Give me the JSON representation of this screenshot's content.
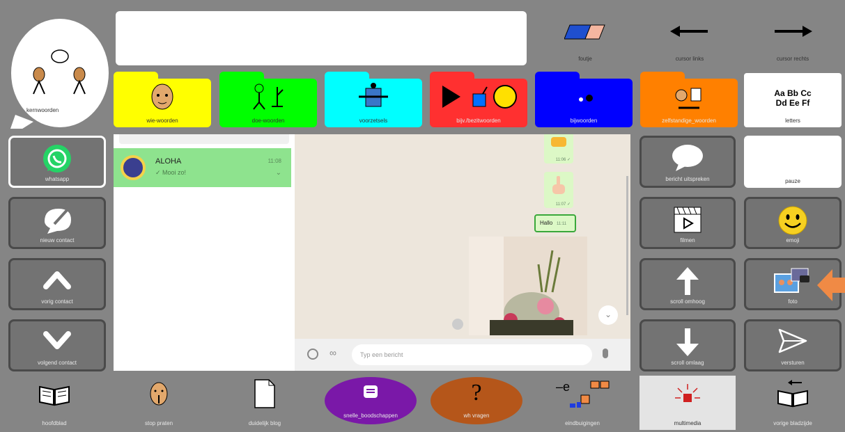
{
  "colors": {
    "background": "#858585",
    "cell": "#737373",
    "accent_orange": "#f08a45",
    "wa_green": "#25d366",
    "bubble_green": "#dcf8c6"
  },
  "core": {
    "label": "kernwoorden"
  },
  "message_box": {
    "value": ""
  },
  "top_actions": [
    {
      "label": "foutje",
      "icon": "eraser-icon"
    },
    {
      "label": "cursor links",
      "icon": "arrow-left-icon"
    },
    {
      "label": "cursor rechts",
      "icon": "arrow-right-icon"
    }
  ],
  "folders": [
    {
      "label": "wie-woorden",
      "color": "#ffff00",
      "icon": "face-icon"
    },
    {
      "label": "doe-woorden",
      "color": "#00ff00",
      "icon": "action-icon"
    },
    {
      "label": "voorzetsels",
      "color": "#00ffff",
      "icon": "box-icon"
    },
    {
      "label": "bijv./bezitwoorden",
      "color": "#ff3030",
      "icon": "shapes-icon"
    },
    {
      "label": "bijwoorden",
      "color": "#0000ff",
      "icon": "dots-icon"
    },
    {
      "label": "zelfstandige_woorden",
      "color": "#ff8000",
      "icon": "objects-icon"
    }
  ],
  "letters": {
    "label": "letters",
    "line1": "Aa Bb Cc",
    "line2": "Dd Ee Ff"
  },
  "left_buttons": [
    {
      "label": "whatsapp",
      "icon": "whatsapp-icon"
    },
    {
      "label": "nieuw contact",
      "icon": "new-chat-icon"
    },
    {
      "label": "vorig contact",
      "icon": "chevron-up-icon"
    },
    {
      "label": "volgend contact",
      "icon": "chevron-down-icon"
    }
  ],
  "right_buttons": [
    {
      "label": "bericht uitspreken",
      "icon": "speech-bubble-icon"
    },
    {
      "label": "pauze",
      "icon": ""
    },
    {
      "label": "filmen",
      "icon": "clapperboard-icon"
    },
    {
      "label": "emoji",
      "icon": "smiley-icon"
    },
    {
      "label": "scroll omhoog",
      "icon": "arrow-up-icon"
    },
    {
      "label": "foto",
      "icon": "photo-icon"
    },
    {
      "label": "scroll omlaag",
      "icon": "arrow-down-icon"
    },
    {
      "label": "versturen",
      "icon": "send-icon"
    }
  ],
  "whatsapp": {
    "chat": {
      "name": "ALOHA",
      "preview": "✓ Mooi zo!",
      "time": "11:08"
    },
    "messages": [
      {
        "type": "emoji",
        "time": "11:06 ✓"
      },
      {
        "type": "emoji",
        "time": "11:07 ✓"
      },
      {
        "type": "text",
        "text": "Hallo",
        "time": "11:11"
      },
      {
        "type": "image"
      }
    ],
    "input_placeholder": "Typ een bericht"
  },
  "bottom": [
    {
      "label": "hoofdblad",
      "icon": "book-icon"
    },
    {
      "label": "stop praten",
      "icon": "hush-icon"
    },
    {
      "label": "duidelijk blog",
      "icon": "page-icon"
    },
    {
      "label": "snelle_boodschappen",
      "icon": "message-icon"
    },
    {
      "label": "wh vragen",
      "icon": "question-icon"
    },
    {
      "label": "eindbuigingen",
      "icon": "grammar-icon"
    },
    {
      "label": "multimedia",
      "icon": "alarm-icon"
    },
    {
      "label": "vorige bladzijde",
      "icon": "book-back-icon"
    }
  ]
}
